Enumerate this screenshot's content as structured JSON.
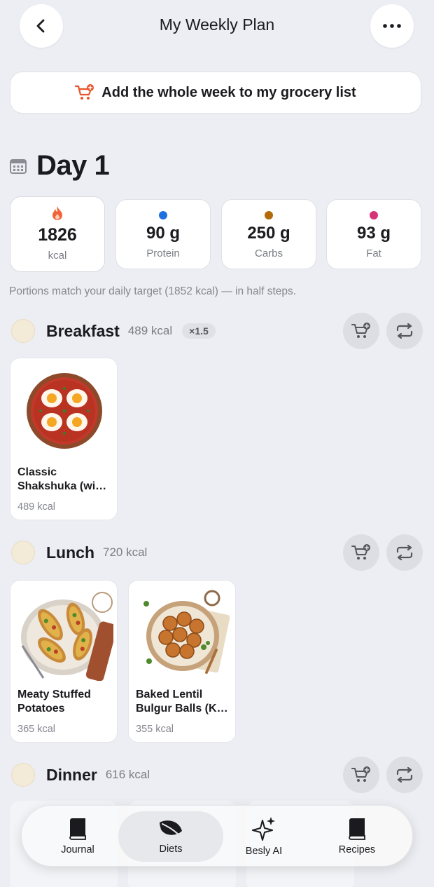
{
  "header": {
    "title": "My Weekly Plan",
    "back_icon": "chevron-left-icon",
    "more_icon": "more-horizontal-icon"
  },
  "grocery": {
    "label": "Add the whole week to my grocery list",
    "icon": "cart-plus-icon",
    "icon_color": "#e8552c"
  },
  "day": {
    "title": "Day 1",
    "icon": "calendar-icon"
  },
  "macros": {
    "kcal": {
      "value": "1826",
      "label": "kcal",
      "icon": "flame-icon",
      "color": "#f0643a"
    },
    "protein": {
      "value": "90 g",
      "label": "Protein",
      "color": "#1f6fe0"
    },
    "carbs": {
      "value": "250 g",
      "label": "Carbs",
      "color": "#b36a08"
    },
    "fat": {
      "value": "93 g",
      "label": "Fat",
      "color": "#d63477"
    }
  },
  "note": "Portions match your daily target (1852 kcal) — in half steps.",
  "meals": {
    "breakfast": {
      "name": "Breakfast",
      "kcal": "489 kcal",
      "multiplier": "×1.5",
      "items": [
        {
          "name": "Classic Shakshuka (wi…",
          "kcal": "489 kcal"
        }
      ]
    },
    "lunch": {
      "name": "Lunch",
      "kcal": "720 kcal",
      "items": [
        {
          "name": "Meaty Stuffed Potatoes",
          "kcal": "365 kcal"
        },
        {
          "name": "Baked Lentil Bulgur Balls (K…",
          "kcal": "355 kcal"
        }
      ]
    },
    "dinner": {
      "name": "Dinner",
      "kcal": "616 kcal"
    }
  },
  "tabs": [
    {
      "label": "Journal",
      "icon": "book-icon",
      "active": false
    },
    {
      "label": "Diets",
      "icon": "leaf-icon",
      "active": true
    },
    {
      "label": "Besly AI",
      "icon": "sparkles-icon",
      "active": false
    },
    {
      "label": "Recipes",
      "icon": "book-icon",
      "active": false
    }
  ]
}
